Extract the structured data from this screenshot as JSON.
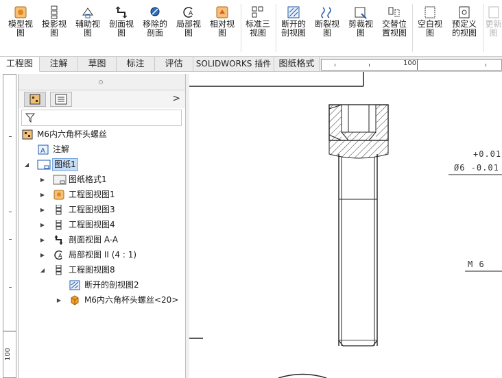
{
  "ribbon": {
    "buttons": [
      {
        "label": "模型视\n图",
        "icon": "model-view-icon"
      },
      {
        "label": "投影视\n图",
        "icon": "projected-view-icon"
      },
      {
        "label": "辅助视\n图",
        "icon": "auxiliary-view-icon"
      },
      {
        "label": "剖面视\n图",
        "icon": "section-view-icon"
      },
      {
        "label": "移除的\n剖面",
        "icon": "removed-section-icon"
      },
      {
        "label": "局部视\n图",
        "icon": "detail-view-icon"
      },
      {
        "label": "相对视\n图",
        "icon": "relative-view-icon"
      },
      {
        "label": "标准三\n视图",
        "icon": "standard-3-view-icon"
      },
      {
        "label": "断开的\n剖视图",
        "icon": "broken-out-section-icon"
      },
      {
        "label": "断裂视\n图",
        "icon": "break-view-icon"
      },
      {
        "label": "剪裁视\n图",
        "icon": "crop-view-icon"
      },
      {
        "label": "交替位\n置视图",
        "icon": "alternate-position-view-icon"
      },
      {
        "label": "空白视\n图",
        "icon": "empty-view-icon"
      },
      {
        "label": "预定义\n的视图",
        "icon": "predefined-view-icon"
      },
      {
        "label": "更新\n图",
        "icon": "update-view-icon"
      }
    ]
  },
  "tabs": [
    {
      "label": "工程图",
      "active": true
    },
    {
      "label": "注解",
      "active": false
    },
    {
      "label": "草图",
      "active": false
    },
    {
      "label": "标注",
      "active": false
    },
    {
      "label": "评估",
      "active": false
    },
    {
      "label": "SOLIDWORKS 插件",
      "active": false
    },
    {
      "label": "图纸格式",
      "active": false
    }
  ],
  "rulers": {
    "horizontal_mark": "100",
    "vertical_mark": "100"
  },
  "feature_tree": {
    "root": "M6内六角杯头螺丝",
    "items": [
      {
        "label": "注解",
        "icon": "annotation-icon"
      },
      {
        "label": "图纸1",
        "icon": "sheet-icon",
        "selected": true,
        "expanded": true
      },
      {
        "label": "图纸格式1",
        "icon": "sheet-format-icon"
      },
      {
        "label": "工程图视图1",
        "icon": "model-view-icon"
      },
      {
        "label": "工程图视图3",
        "icon": "projected-view-icon"
      },
      {
        "label": "工程图视图4",
        "icon": "projected-view-icon"
      },
      {
        "label": "剖面视图 A-A",
        "icon": "section-view-icon"
      },
      {
        "label": "局部视图 II (4 : 1)",
        "icon": "detail-view-icon"
      },
      {
        "label": "工程图视图8",
        "icon": "projected-view-icon",
        "expanded": true
      },
      {
        "label": "断开的剖视图2",
        "icon": "broken-out-section-icon"
      },
      {
        "label": "M6内六角杯头螺丝<20>",
        "icon": "part-icon"
      }
    ]
  },
  "drawing": {
    "tolerance_upper": "+0.01",
    "tolerance_lower": "Ø6 -0.01",
    "thread_label": "M 6"
  },
  "colors": {
    "selection": "#c7dcf5",
    "accent": "#1e5aa8",
    "icon_orange": "#e08a1e"
  }
}
